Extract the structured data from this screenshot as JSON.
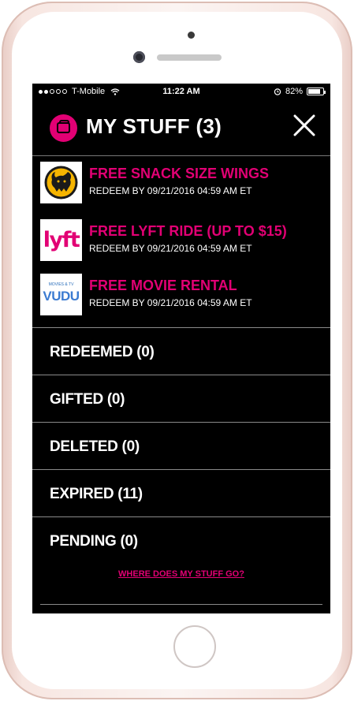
{
  "status_bar": {
    "signal_dots": 5,
    "signal_filled": 2,
    "carrier": "T-Mobile",
    "time": "11:22 AM",
    "battery_text": "82%",
    "battery_level": 0.82
  },
  "header": {
    "title": "MY STUFF (3)",
    "icon": "wallet-icon",
    "close_icon": "close-icon"
  },
  "offers": [
    {
      "logo": "buffalo-wild-wings-logo",
      "title": "FREE SNACK SIZE WINGS",
      "redeem": "REDEEM BY 09/21/2016 04:59 AM ET"
    },
    {
      "logo": "lyft-logo",
      "logo_text": "lyft",
      "title": "FREE LYFT RIDE (UP TO $15)",
      "redeem": "REDEEM BY 09/21/2016 04:59 AM ET"
    },
    {
      "logo": "vudu-logo",
      "logo_small": "MOVIES & TV",
      "logo_text": "VUDU",
      "title": "FREE MOVIE RENTAL",
      "redeem": "REDEEM BY 09/21/2016 04:59 AM ET"
    }
  ],
  "menu": [
    {
      "label": "REDEEMED (0)"
    },
    {
      "label": "GIFTED (0)"
    },
    {
      "label": "DELETED (0)"
    },
    {
      "label": "EXPIRED (11)"
    },
    {
      "label": "PENDING (0)"
    }
  ],
  "help_link": "WHERE DOES MY STUFF GO?",
  "colors": {
    "accent": "#e20074",
    "background": "#000000",
    "text": "#ffffff"
  }
}
